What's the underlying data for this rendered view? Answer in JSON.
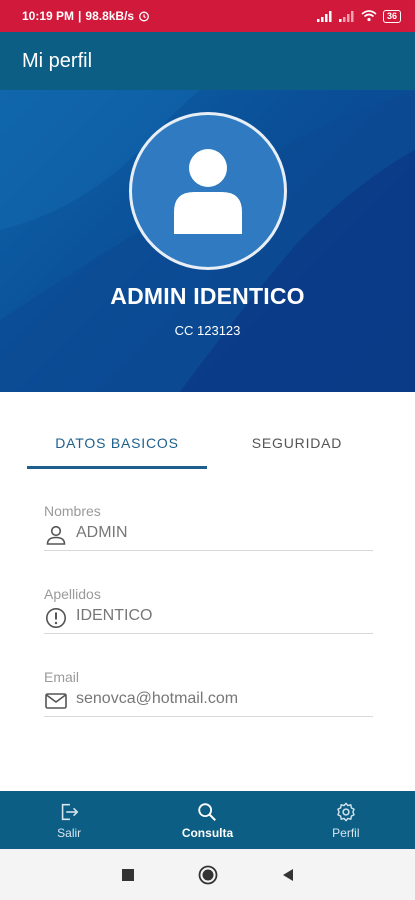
{
  "status_bar": {
    "time": "10:19 PM",
    "speed": "98.8kB/s",
    "battery": "36"
  },
  "app_bar": {
    "title": "Mi perfil"
  },
  "profile": {
    "name": "ADMIN IDENTICO",
    "id": "CC 123123",
    "avatar_icon": "user-avatar-icon"
  },
  "tabs": [
    {
      "label": "DATOS BASICOS",
      "active": true
    },
    {
      "label": "SEGURIDAD",
      "active": false
    }
  ],
  "fields": [
    {
      "label": "Nombres",
      "value": "ADMIN",
      "icon": "person-icon"
    },
    {
      "label": "Apellidos",
      "value": "IDENTICO",
      "icon": "info-icon"
    },
    {
      "label": "Email",
      "value": "senovca@hotmail.com",
      "icon": "mail-icon"
    }
  ],
  "bottom_nav": [
    {
      "label": "Salir",
      "icon": "logout-icon",
      "active": false
    },
    {
      "label": "Consulta",
      "icon": "search-icon",
      "active": true
    },
    {
      "label": "Perfil",
      "icon": "gear-icon",
      "active": false
    }
  ],
  "colors": {
    "status_bar": "#d0193b",
    "primary": "#0c5e84",
    "hero_blue": "#0a4f98",
    "tab_active": "#1e5f8c"
  }
}
